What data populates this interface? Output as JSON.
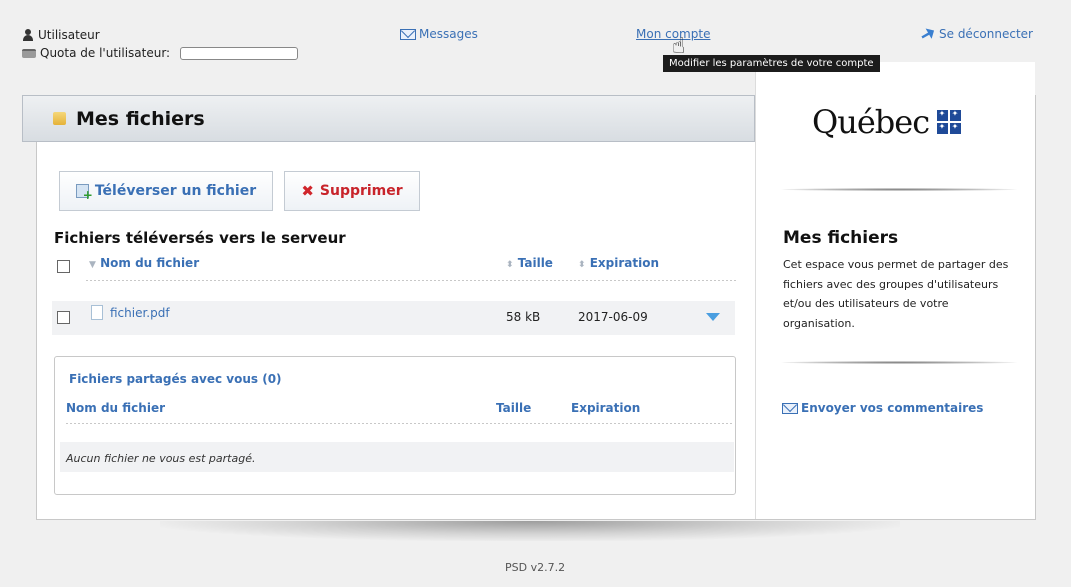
{
  "top": {
    "user_label": "Utilisateur",
    "quota_label": "Quota de l'utilisateur:",
    "messages_label": "Messages",
    "account_label": "Mon compte",
    "account_tooltip": "Modifier les paramètres de votre compte",
    "logout_label": "Se déconnecter"
  },
  "header": {
    "title": "Mes fichiers"
  },
  "toolbar": {
    "upload_label": "Téléverser un fichier",
    "delete_label": "Supprimer"
  },
  "uploaded": {
    "title": "Fichiers téléversés vers le serveur",
    "columns": {
      "name": "Nom du fichier",
      "size": "Taille",
      "expiration": "Expiration"
    },
    "rows": [
      {
        "name": "fichier.pdf",
        "size": "58 kB",
        "expiration": "2017-06-09"
      }
    ]
  },
  "shared": {
    "title": "Fichiers partagés avec vous (0)",
    "columns": {
      "name": "Nom du fichier",
      "size": "Taille",
      "expiration": "Expiration"
    },
    "empty_text": "Aucun fichier ne vous est partagé."
  },
  "sidebar": {
    "logo_text": "Québec",
    "title": "Mes fichiers",
    "description": "Cet espace vous permet de partager des fichiers avec des groupes d'utilisateurs et/ou des utilisateurs de votre organisation.",
    "feedback_label": "Envoyer vos commentaires"
  },
  "footer": {
    "version": "PSD v2.7.2"
  },
  "colors": {
    "link": "#3a70b5",
    "danger": "#c8242b",
    "flag": "#1f4a98"
  }
}
